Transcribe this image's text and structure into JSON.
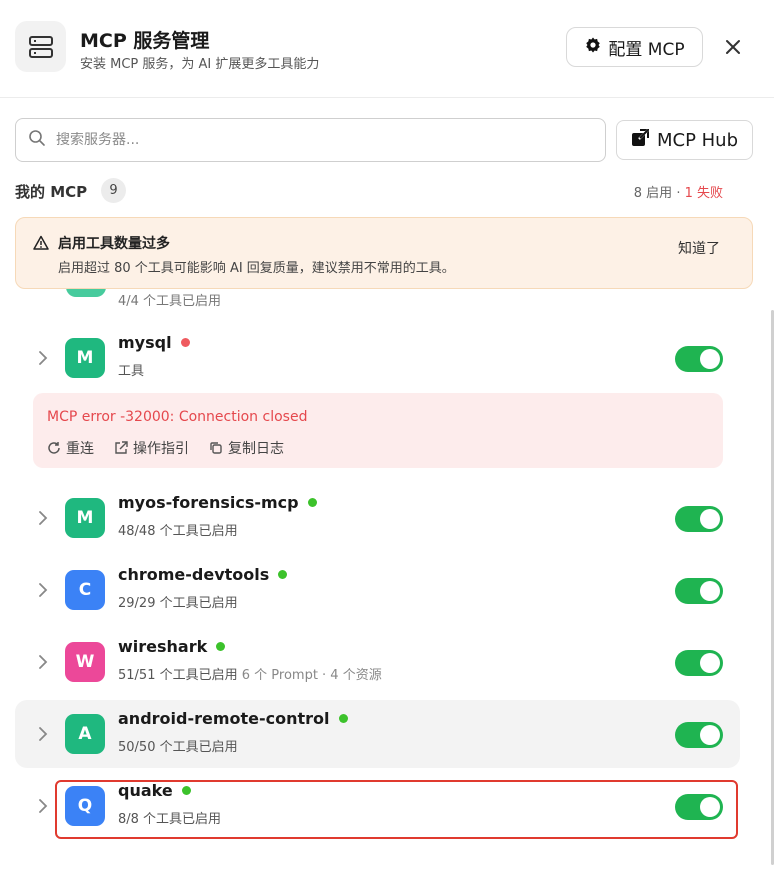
{
  "header": {
    "title": "MCP 服务管理",
    "subtitle": "安装 MCP 服务，为 AI 扩展更多工具能力",
    "config_label": "配置 MCP"
  },
  "search": {
    "placeholder": "搜索服务器...",
    "hub_label": "MCP Hub"
  },
  "section": {
    "title": "我的 MCP",
    "count": "9",
    "enabled_text": "8 启用 · ",
    "failed_text": "1 失败"
  },
  "warning": {
    "title": "启用工具数量过多",
    "body": "启用超过 80 个工具可能影响 AI 回复质量，建议禁用不常用的工具。",
    "dismiss": "知道了"
  },
  "partial_row_text": "4/4 个工具已启用",
  "servers": [
    {
      "letter": "M",
      "name": "mysql",
      "status": "error",
      "subtitle": "工具",
      "extra": "",
      "avatar_color": "#1fb87f",
      "enabled": true
    },
    {
      "letter": "M",
      "name": "myos-forensics-mcp",
      "status": "ok",
      "subtitle": "48/48 个工具已启用",
      "extra": "",
      "avatar_color": "#1fb87f",
      "enabled": true
    },
    {
      "letter": "C",
      "name": "chrome-devtools",
      "status": "ok",
      "subtitle": "29/29 个工具已启用",
      "extra": "",
      "avatar_color": "#3b82f6",
      "enabled": true
    },
    {
      "letter": "W",
      "name": "wireshark",
      "status": "ok",
      "subtitle": "51/51 个工具已启用",
      "extra": " 6 个 Prompt · 4 个资源",
      "avatar_color": "#ec4899",
      "enabled": true
    },
    {
      "letter": "A",
      "name": "android-remote-control",
      "status": "ok",
      "subtitle": "50/50 个工具已启用",
      "extra": "",
      "avatar_color": "#1fb87f",
      "enabled": true
    },
    {
      "letter": "Q",
      "name": "quake",
      "status": "ok",
      "subtitle": "8/8 个工具已启用",
      "extra": "",
      "avatar_color": "#3b82f6",
      "enabled": true
    }
  ],
  "error": {
    "message": "MCP error -32000: Connection closed",
    "reconnect": "重连",
    "guide": "操作指引",
    "copy_log": "复制日志"
  },
  "colors": {
    "ok_dot": "#3cc22b",
    "error_dot": "#ef5a5f",
    "toggle_on": "#1fb451",
    "fail_text": "#e5484d",
    "highlight_border": "#e03a2f"
  }
}
